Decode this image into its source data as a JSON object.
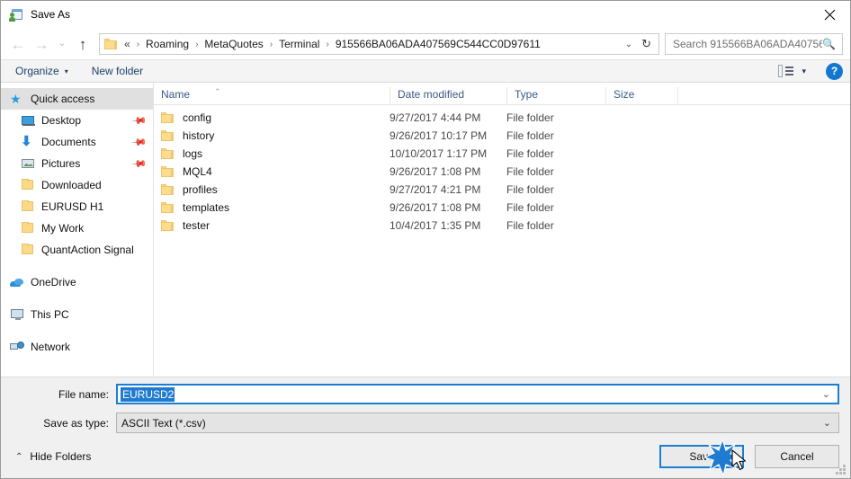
{
  "window": {
    "title": "Save As",
    "app_icon": "save-as-app-icon",
    "close_label": "✕"
  },
  "nav": {
    "back": "←",
    "forward": "→",
    "recent": "⌄",
    "up": "↑",
    "breadcrumb_prefix": "«",
    "crumbs": [
      "Roaming",
      "MetaQuotes",
      "Terminal",
      "915566BA06ADA407569C544CC0D97611"
    ],
    "separator": "›",
    "dropdown_caret": "⌄",
    "refresh": "↻"
  },
  "search": {
    "placeholder": "Search 915566BA06ADA40756...",
    "icon": "search-icon"
  },
  "toolbar": {
    "organize_label": "Organize",
    "organize_caret": "▾",
    "new_folder_label": "New folder",
    "view_caret": "▾",
    "help_label": "?"
  },
  "sidebar": {
    "groups": [
      {
        "header": {
          "label": "Quick access",
          "icon": "star-icon",
          "selected": true
        },
        "items": [
          {
            "label": "Desktop",
            "icon": "desktop-icon",
            "pinned": true
          },
          {
            "label": "Documents",
            "icon": "documents-download-icon",
            "pinned": true
          },
          {
            "label": "Pictures",
            "icon": "pictures-icon",
            "pinned": true
          },
          {
            "label": "Downloaded",
            "icon": "folder-icon",
            "pinned": false
          },
          {
            "label": "EURUSD H1",
            "icon": "folder-icon",
            "pinned": false
          },
          {
            "label": "My Work",
            "icon": "folder-icon",
            "pinned": false
          },
          {
            "label": "QuantAction Signal",
            "icon": "folder-icon",
            "pinned": false
          }
        ]
      },
      {
        "header": {
          "label": "OneDrive",
          "icon": "onedrive-cloud-icon",
          "selected": false
        },
        "items": []
      },
      {
        "header": {
          "label": "This PC",
          "icon": "this-pc-icon",
          "selected": false
        },
        "items": []
      },
      {
        "header": {
          "label": "Network",
          "icon": "network-icon",
          "selected": false
        },
        "items": []
      }
    ],
    "pin_glyph": "📌"
  },
  "filelist": {
    "columns": [
      "Name",
      "Date modified",
      "Type",
      "Size"
    ],
    "sort_caret": "⌃",
    "rows": [
      {
        "name": "config",
        "date": "9/27/2017 4:44 PM",
        "type": "File folder",
        "size": ""
      },
      {
        "name": "history",
        "date": "9/26/2017 10:17 PM",
        "type": "File folder",
        "size": ""
      },
      {
        "name": "logs",
        "date": "10/10/2017 1:17 PM",
        "type": "File folder",
        "size": ""
      },
      {
        "name": "MQL4",
        "date": "9/26/2017 1:08 PM",
        "type": "File folder",
        "size": ""
      },
      {
        "name": "profiles",
        "date": "9/27/2017 4:21 PM",
        "type": "File folder",
        "size": ""
      },
      {
        "name": "templates",
        "date": "9/26/2017 1:08 PM",
        "type": "File folder",
        "size": ""
      },
      {
        "name": "tester",
        "date": "10/4/2017 1:35 PM",
        "type": "File folder",
        "size": ""
      }
    ]
  },
  "form": {
    "file_name_label": "File name:",
    "file_name_value": "EURUSD2",
    "file_name_caret": "⌄",
    "save_as_type_label": "Save as type:",
    "save_as_type_value": "ASCII Text (*.csv)",
    "save_as_type_caret": "⌄"
  },
  "footer": {
    "hide_folders_label": "Hide Folders",
    "hide_folders_caret": "⌃",
    "save_label": "Save",
    "cancel_label": "Cancel"
  },
  "colors": {
    "accent": "#1a7fd4",
    "crumb_text": "#1a1a1a",
    "header_text": "#3b5a84",
    "folder": "#fcdd8d",
    "selection": "#1f7bd0"
  }
}
